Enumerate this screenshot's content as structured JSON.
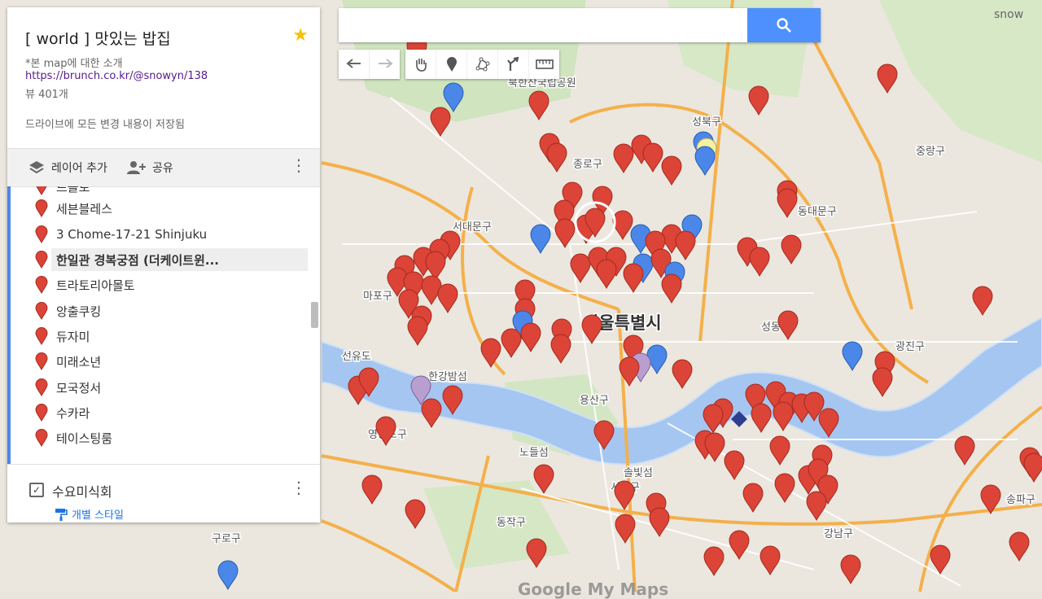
{
  "map_name": "[ world ] 맛있는 밥집",
  "description": "*본 map에 대한 소개",
  "link": "https://brunch.co.kr/@snowyn/138",
  "views": "뷰 401개",
  "save_status": "드라이브에 모든 변경 내용이 저장됨",
  "toolbar": {
    "add_layer": "레이어 추가",
    "share": "공유"
  },
  "layer_items": [
    {
      "label": "르볼로",
      "color": "#db4437"
    },
    {
      "label": "세븐블레스",
      "color": "#db4437"
    },
    {
      "label": "3 Chome-17-21 Shinjuku",
      "color": "#db4437"
    },
    {
      "label": "한일관 경복궁점 (더케이트윈...",
      "color": "#db4437",
      "selected": true
    },
    {
      "label": "트라토리아몰토",
      "color": "#db4437"
    },
    {
      "label": "앙출쿠킹",
      "color": "#db4437"
    },
    {
      "label": "듀자미",
      "color": "#db4437"
    },
    {
      "label": "미래소년",
      "color": "#db4437"
    },
    {
      "label": "모국정서",
      "color": "#db4437"
    },
    {
      "label": "수카라",
      "color": "#db4437"
    },
    {
      "label": "테이스팅룸",
      "color": "#db4437"
    }
  ],
  "layer2": {
    "name": "수요미식회",
    "checked": true,
    "style_link": "개별 스타일"
  },
  "search": {
    "value": "",
    "placeholder": ""
  },
  "corner_text": "snow",
  "watermark": "Google My Maps",
  "colors": {
    "accent": "#4d90fe",
    "pin_red": "#db4437",
    "pin_blue": "#4a87e8",
    "pin_yellow": "#f4f1a0",
    "pin_purple": "#b99fcf",
    "river": "#a5c6f0",
    "road": "#f4b04a"
  },
  "map_labels": [
    "북한산국립공원",
    "성북구",
    "종로구",
    "중랑구",
    "동대문구",
    "서대문구",
    "마포구",
    "서울특별시",
    "성동구",
    "광진구",
    "선유도",
    "한강밤섬",
    "용산구",
    "영등포구",
    "노들섬",
    "솔빛섬",
    "서초구",
    "동작구",
    "강남구",
    "구로구",
    "송파구"
  ]
}
